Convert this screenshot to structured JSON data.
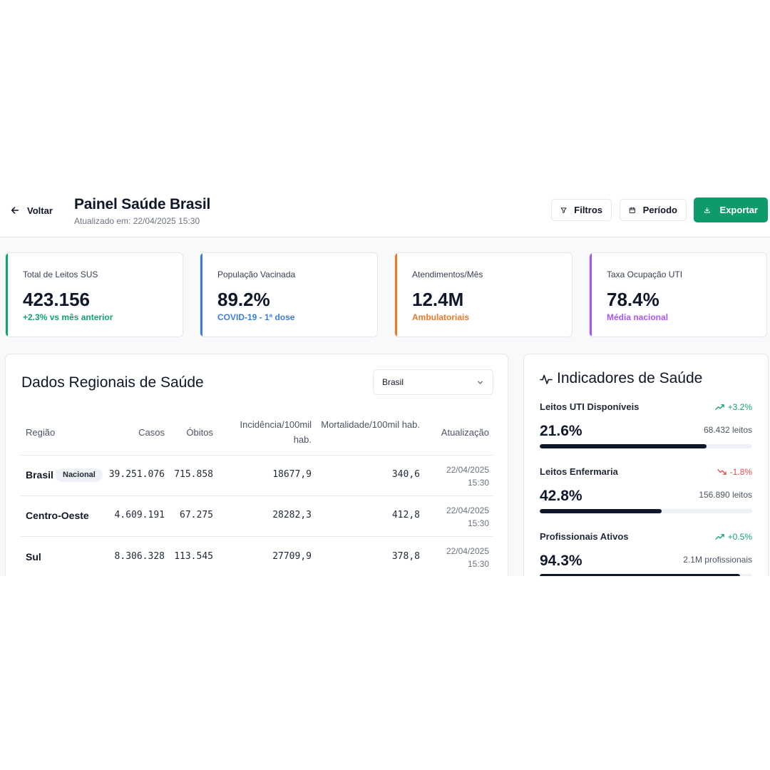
{
  "header": {
    "back_label": "Voltar",
    "title": "Painel Saúde Brasil",
    "subtitle": "Atualizado em: 22/04/2025 15:30",
    "filters_label": "Filtros",
    "period_label": "Período",
    "export_label": "Exportar"
  },
  "stats": [
    {
      "label": "Total de Leitos SUS",
      "value": "423.156",
      "note": "+2.3% vs mês anterior",
      "color": "#10a36f"
    },
    {
      "label": "População Vacinada",
      "value": "89.2%",
      "note": "COVID-19 - 1ª dose",
      "color": "#3b7ddd"
    },
    {
      "label": "Atendimentos/Mês",
      "value": "12.4M",
      "note": "Ambulatoriais",
      "color": "#ea7a2a"
    },
    {
      "label": "Taxa Ocupação UTI",
      "value": "78.4%",
      "note": "Média nacional",
      "color": "#a855f7"
    }
  ],
  "regional": {
    "title": "Dados Regionais de Saúde",
    "select_value": "Brasil",
    "columns": [
      "Região",
      "Casos",
      "Óbitos",
      "Incidência/100mil hab.",
      "Mortalidade/100mil hab.",
      "Atualização"
    ],
    "rows": [
      {
        "region": "Brasil",
        "badge": "Nacional",
        "cases": "39.251.076",
        "deaths": "715.858",
        "incidence": "18677,9",
        "mortality": "340,6",
        "date": "22/04/2025",
        "time": "15:30"
      },
      {
        "region": "Centro-Oeste",
        "badge": "",
        "cases": "4.609.191",
        "deaths": "67.275",
        "incidence": "28282,3",
        "mortality": "412,8",
        "date": "22/04/2025",
        "time": "15:30"
      },
      {
        "region": "Sul",
        "badge": "",
        "cases": "8.306.328",
        "deaths": "113.545",
        "incidence": "27709,9",
        "mortality": "378,8",
        "date": "22/04/2025",
        "time": "15:30"
      }
    ]
  },
  "indicators": {
    "title": "Indicadores de Saúde",
    "icon": "activity-icon",
    "items": [
      {
        "label": "Leitos UTI Disponíveis",
        "change": "+3.2%",
        "trend": "up",
        "value": "21.6%",
        "sub": "68.432 leitos",
        "progress": 0.786,
        "trend_color": "#10a36f"
      },
      {
        "label": "Leitos Enfermaria",
        "change": "-1.8%",
        "trend": "down",
        "value": "42.8%",
        "sub": "156.890 leitos",
        "progress": 0.575,
        "trend_color": "#e5484d"
      },
      {
        "label": "Profissionais Ativos",
        "change": "+0.5%",
        "trend": "up",
        "value": "94.3%",
        "sub": "2.1M profissionais",
        "progress": 0.943,
        "trend_color": "#10a36f"
      }
    ]
  }
}
